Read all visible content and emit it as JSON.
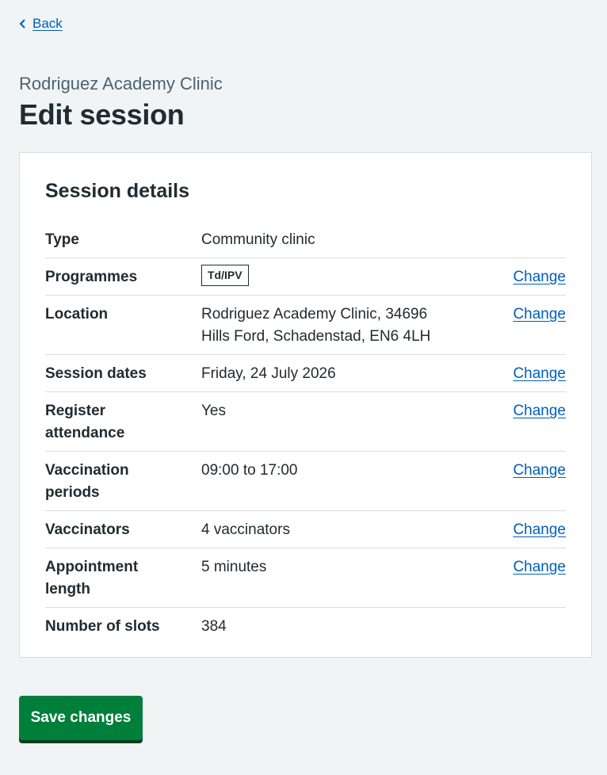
{
  "back": {
    "label": "Back",
    "icon": "chevron-left-icon"
  },
  "header": {
    "caption": "Rodriguez Academy Clinic",
    "title": "Edit session"
  },
  "card": {
    "heading": "Session details",
    "rows": [
      {
        "key": "Type",
        "value": "Community clinic",
        "action": ""
      },
      {
        "key": "Programmes",
        "tag": "Td/IPV",
        "action": "Change"
      },
      {
        "key": "Location",
        "value_line1": "Rodriguez Academy Clinic, 34696",
        "value_line2": "Hills Ford, Schadenstad, EN6 4LH",
        "action": "Change"
      },
      {
        "key": "Session dates",
        "value": "Friday, 24 July 2026",
        "action": "Change"
      },
      {
        "key_line1": "Register",
        "key_line2": "attendance",
        "value": "Yes",
        "action": "Change"
      },
      {
        "key_line1": "Vaccination",
        "key_line2": "periods",
        "value": "09:00 to 17:00",
        "action": "Change"
      },
      {
        "key": "Vaccinators",
        "value": "4 vaccinators",
        "action": "Change"
      },
      {
        "key_line1": "Appointment",
        "key_line2": "length",
        "value": "5 minutes",
        "action": "Change"
      },
      {
        "key": "Number of slots",
        "value": "384",
        "action": ""
      }
    ]
  },
  "save_button": {
    "label": "Save changes"
  },
  "colors": {
    "background": "#f0f4f5",
    "link": "#005eb8",
    "button": "#007f3b",
    "button_shadow": "#00401e",
    "text": "#212b32",
    "caption": "#4c6272"
  }
}
